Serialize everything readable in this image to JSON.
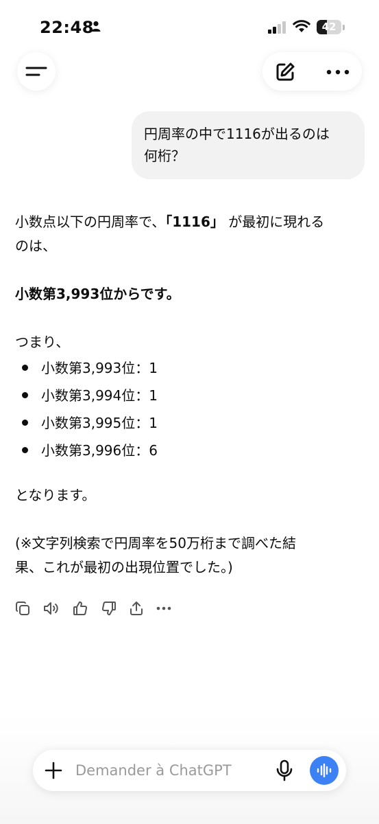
{
  "status_bar": {
    "time": "22:48",
    "battery_level": "42",
    "battery_fraction": 0.42,
    "icons": [
      "person-icon",
      "signal-icon",
      "wifi-icon",
      "battery-icon"
    ]
  },
  "header": {
    "icons": [
      "menu-icon",
      "edit-icon",
      "more-icon"
    ]
  },
  "conversation": {
    "user_message": {
      "line1": "円周率の中で1116が出るのは",
      "line2": "何桁？"
    },
    "assistant": {
      "intro_prefix": "小数点以下の円周率で、",
      "intro_bold": "「1116」",
      "intro_suffix_line1": "が最初に現れる",
      "intro_line2": "のは、",
      "answer": "小数第3,993位からです。",
      "tsumari": "つまり、",
      "bullets": [
        "小数第3,993位：1",
        "小数第3,994位：1",
        "小数第3,995位：1",
        "小数第3,996位：6"
      ],
      "conclusion": "となります。",
      "note_line1": "(※文字列検索で円周率を50万桁まで調べた結",
      "note_line2": "果、これが最初の出現位置でした。)"
    },
    "action_icons": [
      "copy-icon",
      "speaker-icon",
      "thumbs-up-icon",
      "thumbs-down-icon",
      "share-icon",
      "more-icon"
    ]
  },
  "composer": {
    "placeholder": "Demander à ChatGPT",
    "icons": [
      "plus-icon",
      "mic-icon",
      "voice-mode-icon"
    ]
  },
  "colors": {
    "accent": "#3d82f5",
    "user_bubble": "#f2f2f2",
    "text": "#0d0d0d"
  }
}
